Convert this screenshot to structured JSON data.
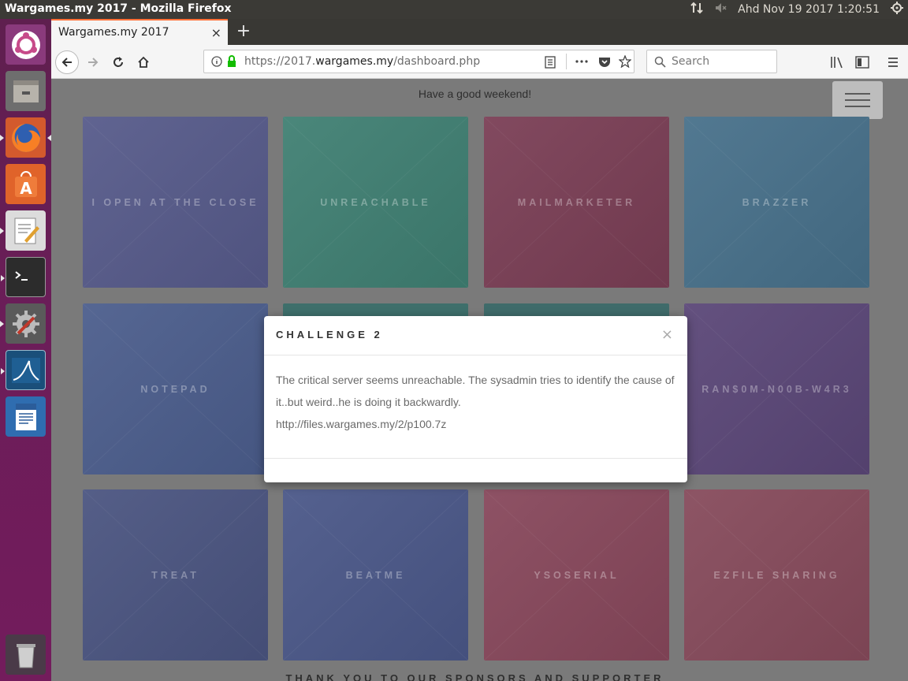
{
  "window": {
    "title": "Wargames.my 2017 - Mozilla Firefox"
  },
  "tray": {
    "datetime": "Ahd Nov 19 2017  1:20:51"
  },
  "browser": {
    "tab_title": "Wargames.my 2017",
    "tab_close": "×",
    "new_tab": "+",
    "url_prefix": "https://2017.",
    "url_domain": "wargames.my",
    "url_path": "/dashboard.php",
    "search_placeholder": "Search"
  },
  "page": {
    "greeting": "Have a good weekend!",
    "footer": "THANK YOU TO OUR SPONSORS AND SUPPORTER",
    "challenges": [
      {
        "name": "I OPEN AT THE CLOSE",
        "color": "#565a8a"
      },
      {
        "name": "UNREACHABLE",
        "color": "#3f7f72"
      },
      {
        "name": "MAILMARKETER",
        "color": "#7a3e55"
      },
      {
        "name": "BRAZZER",
        "color": "#47708a"
      },
      {
        "name": "NOTEPAD",
        "color": "#4b5d8c"
      },
      {
        "name": "RAN$0M-N00B-W4R3",
        "color": "#5a4677"
      },
      {
        "name": "TREAT",
        "color": "#4a5480"
      },
      {
        "name": "BEATME",
        "color": "#4a5788"
      },
      {
        "name": "YSOSERIAL",
        "color": "#87475b"
      },
      {
        "name": "EZFILE SHARING",
        "color": "#864a5b"
      }
    ]
  },
  "modal": {
    "title": "CHALLENGE 2",
    "close": "×",
    "body_line": "The critical server seems unreachable. The sysadmin tries to identify the cause of it..but weird..he is doing it backwardly.",
    "link": "http://files.wargames.my/2/p100.7z"
  }
}
